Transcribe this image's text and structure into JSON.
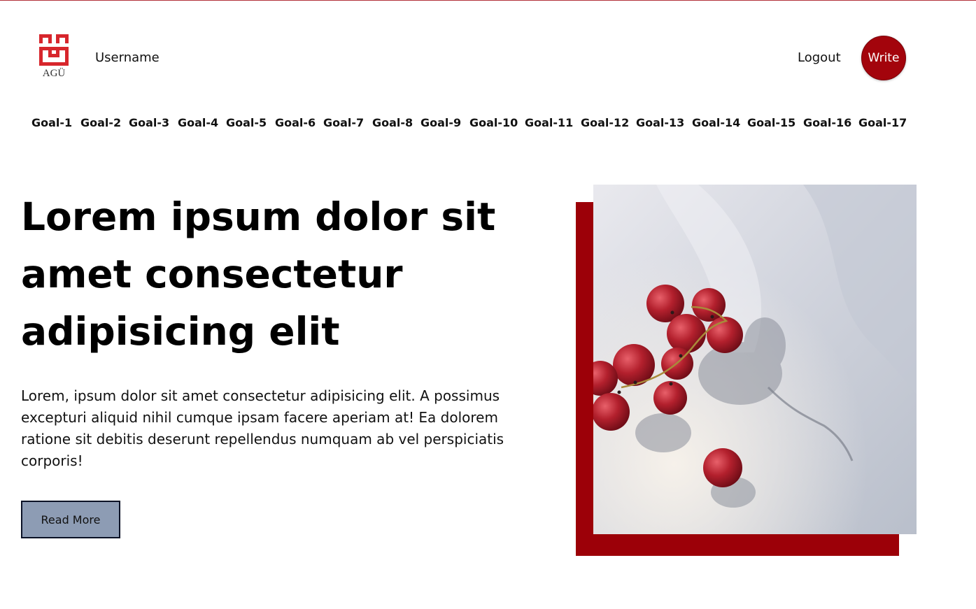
{
  "header": {
    "logo_text": "AGÜ",
    "username": "Username",
    "logout_label": "Logout",
    "write_label": "Write"
  },
  "goals": [
    "Goal-1",
    "Goal-2",
    "Goal-3",
    "Goal-4",
    "Goal-5",
    "Goal-6",
    "Goal-7",
    "Goal-8",
    "Goal-9",
    "Goal-10",
    "Goal-11",
    "Goal-12",
    "Goal-13",
    "Goal-14",
    "Goal-15",
    "Goal-16",
    "Goal-17"
  ],
  "hero": {
    "title": "Lorem ipsum dolor sit amet consectetur adipisicing elit",
    "description": "Lorem, ipsum dolor sit amet consectetur adipisicing elit. A possimus excepturi aliquid nihil cumque ipsam facere aperiam at! Ea dolorem ratione sit debitis deserunt repellendus numquam ab vel perspiciatis corporis!",
    "read_more_label": "Read More"
  },
  "colors": {
    "accent": "#a3040c",
    "button_bg": "#8d9cb4"
  }
}
